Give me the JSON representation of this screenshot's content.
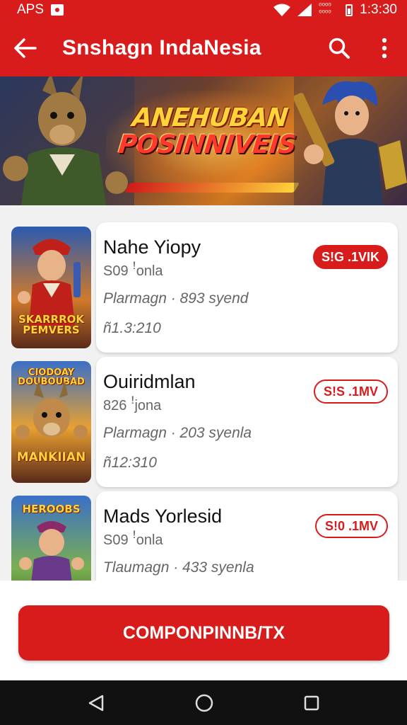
{
  "status_bar": {
    "carrier": "APS",
    "small_text": "⁰⁰⁰⁰ ⁰⁰⁰⁰",
    "time": "1:3:30"
  },
  "app_bar": {
    "title": "Snshagn IndaNesia",
    "back_icon": "arrow-left-icon",
    "search_icon": "search-icon",
    "menu_icon": "more-vert-icon"
  },
  "banner": {
    "line1": "ANEHUBAN",
    "line2": "POSINNIVEIS"
  },
  "games": [
    {
      "title": "Nahe Yiopy",
      "subtitle": "S09 ꜝonla",
      "meta": "Plarmagn  ·  893 syend",
      "price": "ñ1.3:210",
      "badge": "S!G .1VIK",
      "badge_style": "filled",
      "thumb_text_top": "",
      "thumb_text": "SKARRROK\nPEMVERS"
    },
    {
      "title": "Ouiridmlan",
      "subtitle": "826 ꜝjona",
      "meta": "Plarmagn  ·  203 syenla",
      "price": "ñ12:310",
      "badge": "S!S .1MV",
      "badge_style": "outline",
      "thumb_text_top": "CIODOAY\nDOUBOUBAD",
      "thumb_text": "MANKIIAN"
    },
    {
      "title": "Mads Yorlesid",
      "subtitle": "S09 ꜝonla",
      "meta": "Tlaumagn  ·  433 syenla",
      "price": "",
      "badge": "S!0 .1MV",
      "badge_style": "outline",
      "thumb_text_top": "HEROOBS",
      "thumb_text": ""
    }
  ],
  "cta": {
    "label": "COMPONPINNB/TX"
  },
  "colors": {
    "primary": "#d81b1b",
    "background": "#f1f1f1",
    "nav": "#111111"
  }
}
